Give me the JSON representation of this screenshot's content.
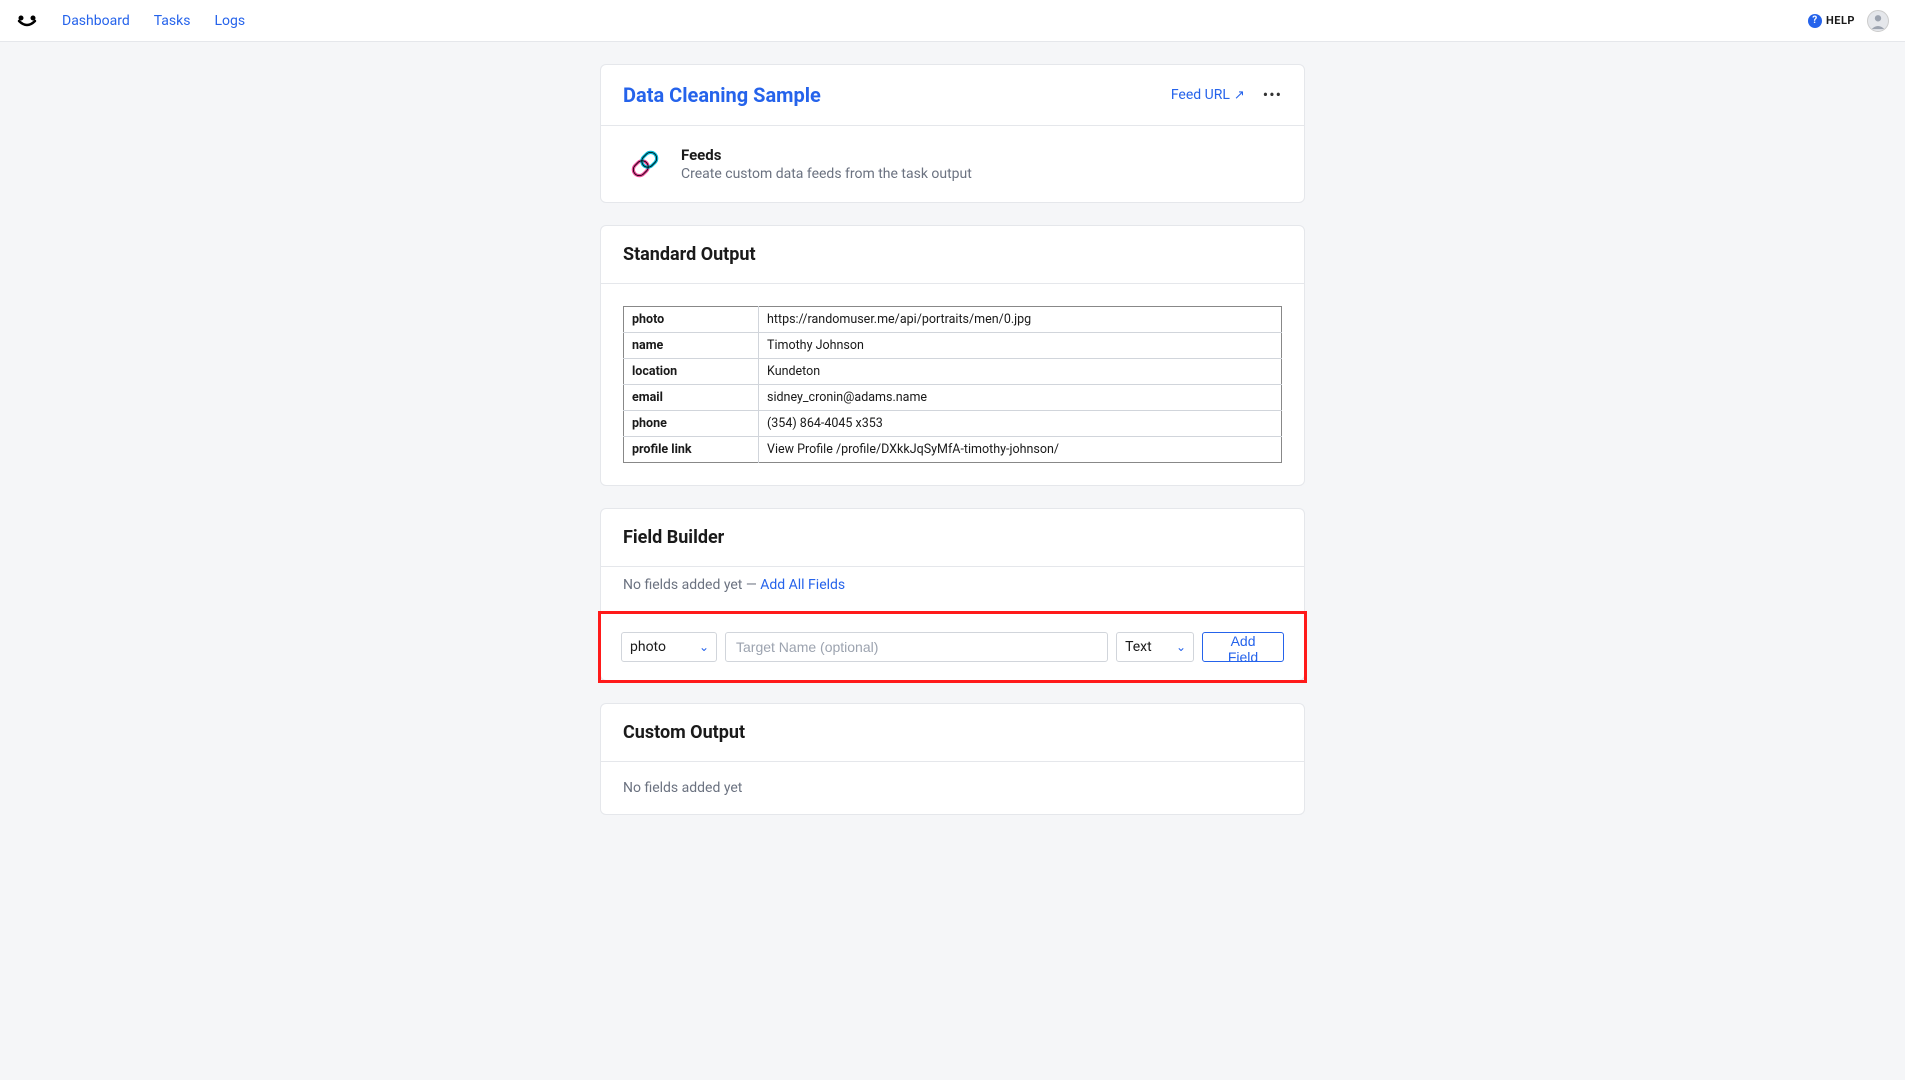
{
  "nav": {
    "dashboard": "Dashboard",
    "tasks": "Tasks",
    "logs": "Logs"
  },
  "help_label": "HELP",
  "task": {
    "title": "Data Cleaning Sample",
    "feed_url_label": "Feed URL"
  },
  "feeds_section": {
    "title": "Feeds",
    "subtitle": "Create custom data feeds from the task output"
  },
  "standard_output": {
    "title": "Standard Output",
    "rows": [
      {
        "key": "photo",
        "value": "https://randomuser.me/api/portraits/men/0.jpg"
      },
      {
        "key": "name",
        "value": "Timothy Johnson"
      },
      {
        "key": "location",
        "value": "Kundeton"
      },
      {
        "key": "email",
        "value": "sidney_cronin@adams.name"
      },
      {
        "key": "phone",
        "value": "(354) 864-4045 x353"
      },
      {
        "key": "profile link",
        "value": "View Profile /profile/DXkkJqSyMfA-timothy-johnson/"
      }
    ]
  },
  "field_builder": {
    "title": "Field Builder",
    "empty_prefix": "No fields added yet — ",
    "add_all_label": "Add All Fields",
    "source_selected": "photo",
    "target_placeholder": "Target Name (optional)",
    "type_selected": "Text",
    "add_field_label": "Add Field"
  },
  "custom_output": {
    "title": "Custom Output",
    "empty": "No fields added yet"
  }
}
